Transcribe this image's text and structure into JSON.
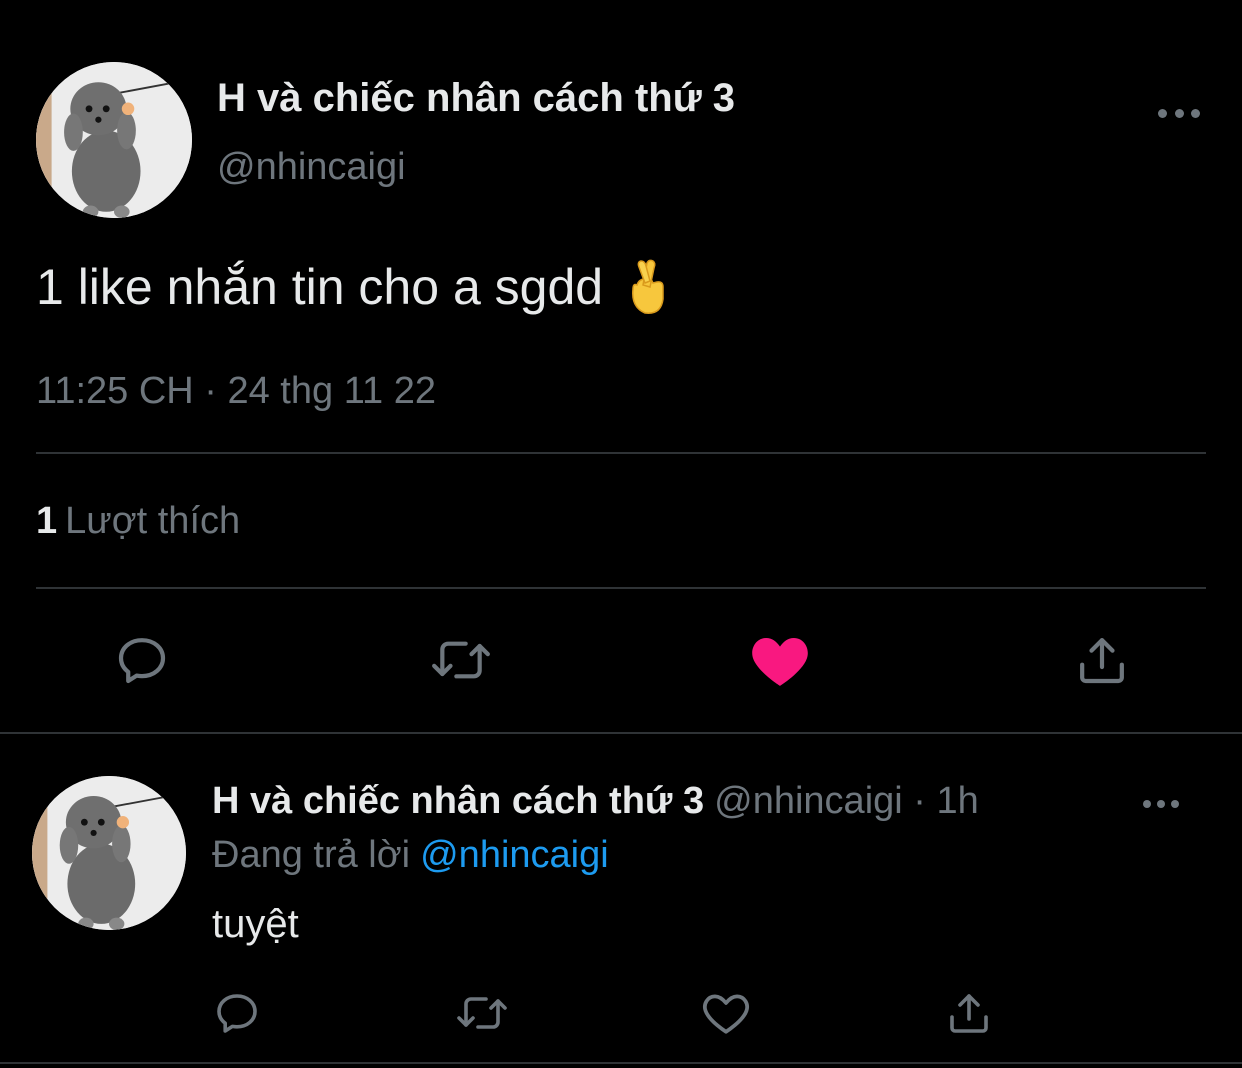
{
  "tweet": {
    "author_name": "H và chiếc nhân cách thứ 3",
    "author_handle": "@nhincaigi",
    "text": "1 like nhắn tin cho a sgdd",
    "emoji": "crossed-fingers-emoji",
    "timestamp": "11:25 CH · 24 thg 11 22",
    "likes_count": "1",
    "likes_label": "Lượt thích",
    "liked": true,
    "actions": [
      "reply-icon",
      "retweet-icon",
      "heart-icon",
      "share-icon"
    ],
    "like_color": "#f91880"
  },
  "reply": {
    "author_name": "H và chiếc nhân cách thứ 3",
    "meta": "@nhincaigi · 1h",
    "replying_label": "Đang trả lời",
    "replying_to": "@nhincaigi",
    "text": "tuyệt",
    "liked": false,
    "actions": [
      "reply-icon",
      "retweet-icon",
      "heart-icon",
      "share-icon"
    ]
  },
  "theme": {
    "background": "#000000",
    "text_primary": "#e7e9ea",
    "text_secondary": "#6e767d",
    "link": "#1d9bf0",
    "divider": "#2f3336"
  }
}
